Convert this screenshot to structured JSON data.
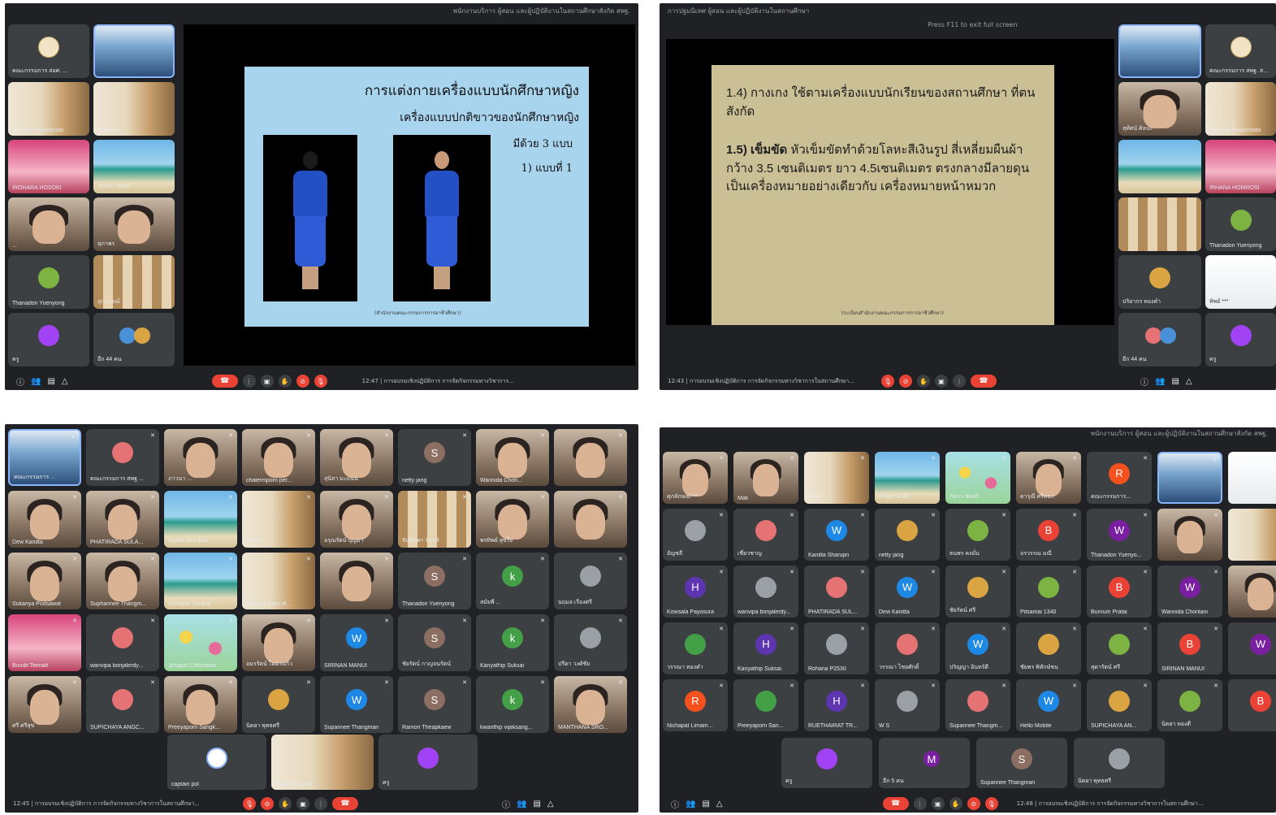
{
  "panel1": {
    "topbar": "พนักงานบริการ ผู้สอน และผู้ปฏิบัติงานในสถานศึกษาสังกัด สพฐ.",
    "slide": {
      "title": "การแต่งกายเครื่องแบบนักศึกษาหญิง",
      "subtitle": "เครื่องแบบปกติขาวของนักศึกษาหญิง",
      "line1": "มีด้วย 3 แบบ",
      "line2": "1) แบบที่ 1",
      "footer": "(สำนักงานคณะกรรมการการอาชีวศึกษา)"
    },
    "left_tiles": [
      "คณะกรรมการ สอศ. ...",
      "Saruchs Hutachinda",
      "IROHARA HOSOKI",
      "...",
      "Thanadon Yuenyong",
      "ครู"
    ],
    "right_tiles": [
      "",
      "Wanvipa",
      "วรรณา สุขศรี",
      "สุภาพร",
      "สุภาภรณ์",
      "อีก 44 คน"
    ],
    "footer": "12:47 | การอบรมเชิงปฏิบัติการ การจัดกิจกรรมทางวิชาการ..."
  },
  "panel2": {
    "topbar": "การปฐมนิเทศ ผู้สอน และผู้ปฏิบัติงานในสถานศึกษา",
    "hint": "Press  F11  to exit full screen",
    "slide": {
      "p1": "1.4) กางเกง ใช้ตามเครื่องแบบนักเรียนของสถานศึกษา ที่ตนสังกัด",
      "p2_bold": "1.5) เข็มขัด",
      "p2": " หัวเข็มขัดทำด้วยโลหะสีเงินรูป สี่เหลี่ยมผืนผ้า กว้าง 3.5 เซนติเมตร ยาว 4.5เซนติเมตร ตรงกลางมีลายดุนเป็นเครื่องหมายอย่างเดียวกับ เครื่องหมายหน้าหมวก",
      "footer": "(ระเบียบสำนักงานคณะกรรมการการอาชีวศึกษา)"
    },
    "tiles_left": [
      "",
      "สุทัศน์ ศิลปะ",
      "",
      "",
      "ปริยากร ทองคำ",
      "อีก 44 คน"
    ],
    "tiles_right": [
      "คณะกรรมการ สพฐ. สนง ...",
      "Sarucha Hutachinda",
      "IRHANA HOMROSI",
      "Thanadon Yuenyong",
      "ทิพย์ ***",
      "ครู"
    ],
    "footer": "12:43 | การอบรมเชิงปฏิบัติการ การจัดกิจกรรมทางวิชาการในสถานศึกษา..."
  },
  "panel3": {
    "tiles": [
      "คณะกรรมการ ...",
      "คณะกรรมการ สพฐ ...",
      "ภาวนา ...",
      "chalermporn per...",
      "สุนิสา มะแนน",
      "netty jang",
      "Wannida Choh...",
      "",
      "Dew Kanitta",
      "PHATIRADA SULA...",
      "อัญชลี ทองเนียม",
      "สุวิมล...",
      "อรุณรัตน์ บุญมา",
      "จันทิพพา จันทร์",
      "พรทิพย์ สุขใจ",
      "",
      "Sukanya Podsawat",
      "Suphannee Thangm...",
      "Nichapat Sorarat",
      "Morakot Kam-el...",
      "",
      "Thanadon Yuenyong",
      "สมัยพี ...",
      "นฤมล เรืองศรี",
      "Bundit Teeralit",
      "wanvipa bonjalerdy...",
      "Jintapat Chitchaisri",
      "อมรรัตน์ โคตรแก้ว",
      "SIRINAN MANUI",
      "ชัยรัตน์ กาญจนรัตน์",
      "Kanyathip Suksai",
      "ปรีดา วงศ์ชัย",
      "ศรี ศรีสุข",
      "SUPICHAYA ANGC...",
      "Preeyaporn Sangk...",
      "นิตยา พุทธศรี",
      "Supannee Thangman",
      "Ramon Theapkaew",
      "kwanthip vijaksang...",
      "MANTHANA SRO..."
    ],
    "bottom_tiles": [
      "captain pol",
      "Pitsamai 1340",
      "ครู"
    ],
    "avatars": {
      "w": "W",
      "s": "S",
      "k": "k"
    },
    "footer": "12:45 | การอบรมเชิงปฏิบัติการ การจัดกิจกรรมทางวิชาการในสถานศึกษา..."
  },
  "panel4": {
    "topbar": "พนักงานบริการ ผู้สอน และผู้ปฏิบัติงานในสถานศึกษาสังกัด สพฐ.",
    "tiles": [
      "ศุภลักษณ์ ***",
      "Mali",
      "ศิริพร",
      "ศรีสุดา คงดี",
      "ภัทรา ชัยศรี",
      "ดารุณี ศรีทอง",
      "คณะกรรมการ...",
      "",
      "",
      "อัญชลี",
      "เชี่ยวชาญ",
      "Kanitta Sharupn",
      "netty jang",
      "ธนพร คงมั่น",
      "อรวรรณ มณี",
      "Thanadon Yuenyo...",
      "",
      "",
      "Kowsala Payosura",
      "wanvipa bonjalerdy...",
      "PHATIRADA SUL...",
      "Dew Kanitta",
      "ชัยรัตน์ ศรี",
      "Pitsamai 1340",
      "Bunrum Pratai",
      "Wannida Chonlani",
      "",
      "วรรณา ทองคำ",
      "Kanyathip Suksai",
      "Rohana P2530",
      "วรรณา ไชยศักดิ์",
      "ปริญญา อินทร์ดี",
      "ชัยพร พิทักษ์ชน",
      "สุดารัตน์ ศรี",
      "SIRINAN MANUI",
      "",
      "Nichapat Limam...",
      "Preeyaporn San...",
      "RUETHAIRAT TR...",
      "W S",
      "Supannee Thangm...",
      "Hello Mobile",
      "SUPICHAYA AN...",
      "นิตยา ทองดี",
      ""
    ],
    "bottom_tiles": [
      "ครู",
      "อีก 5 คน",
      "Supannee Thangman",
      "นิตยา พุทธศรี"
    ],
    "avatars": {
      "w": "W",
      "b": "B",
      "r": "R",
      "h": "H",
      "m": "M",
      "s": "S"
    },
    "footer": "12:48 | การอบรมเชิงปฏิบัติการ การจัดกิจกรรมทางวิชาการในสถานศึกษา..."
  },
  "colors": {
    "meet_bg": "#202124",
    "tile_bg": "#3c4043",
    "hangup": "#ea4335",
    "slide1_bg": "#a9d4ee",
    "slide2_bg": "#cbbf96",
    "host_border": "#8ab4f8"
  }
}
